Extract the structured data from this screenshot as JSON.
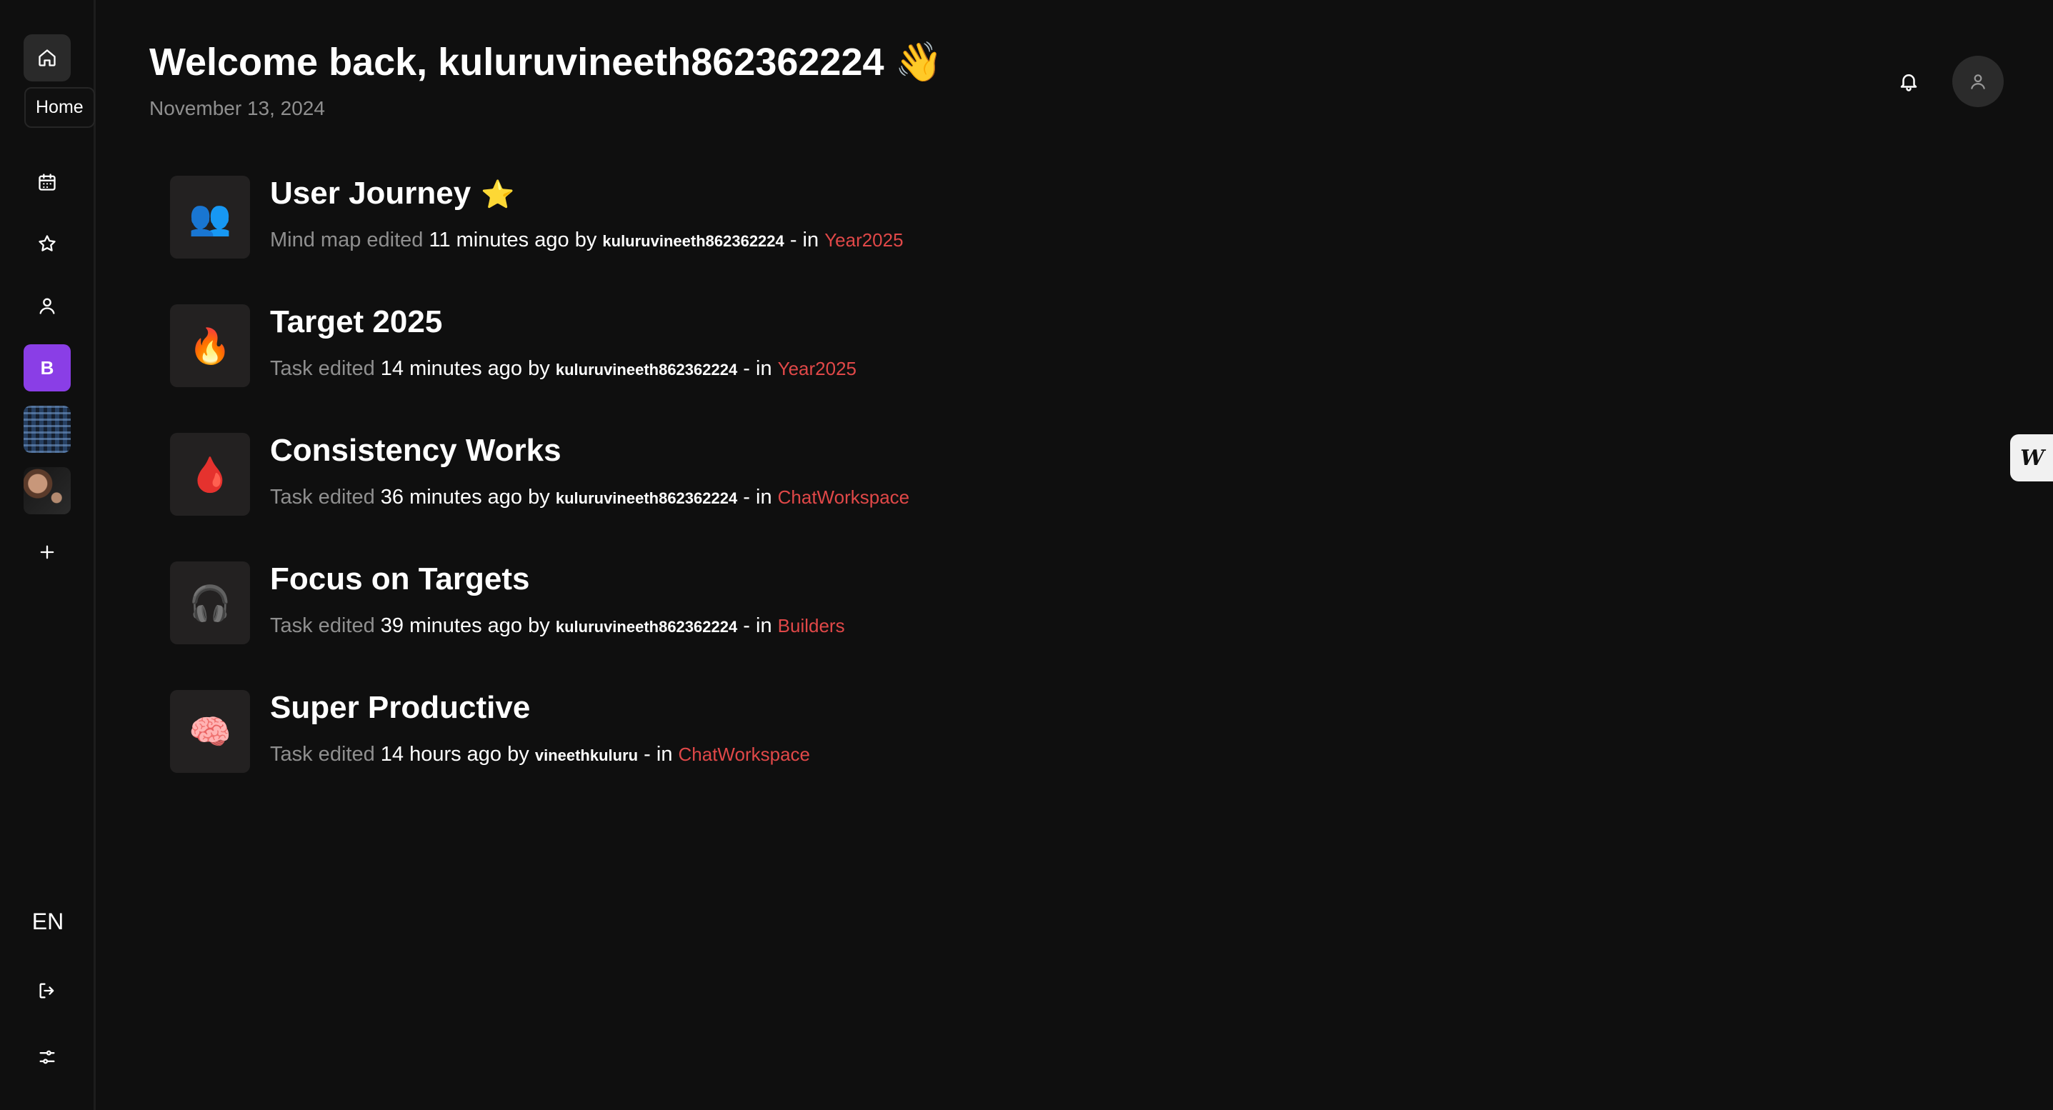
{
  "sidebar": {
    "home_tooltip": "Home",
    "workspace_badge": "B",
    "language": "EN",
    "icons": [
      "home-icon",
      "calendar-icon",
      "star-icon",
      "user-icon",
      "plus-icon",
      "logout-icon",
      "settings-sliders-icon"
    ]
  },
  "header": {
    "title": "Welcome back, kuluruvineeth862362224 👋",
    "date": "November 13, 2024"
  },
  "activity": [
    {
      "icon": "👥",
      "title": "User Journey",
      "starred": true,
      "type": "Mind map edited",
      "time": "11 minutes ago",
      "by": "by",
      "user": "kuluruvineeth862362224",
      "in": "- in",
      "workspace": "Year2025"
    },
    {
      "icon": "🔥",
      "title": "Target 2025",
      "starred": false,
      "type": "Task edited",
      "time": "14 minutes ago",
      "by": "by",
      "user": "kuluruvineeth862362224",
      "in": "- in",
      "workspace": "Year2025"
    },
    {
      "icon": "🩸",
      "title": "Consistency Works",
      "starred": false,
      "type": "Task edited",
      "time": "36 minutes ago",
      "by": "by",
      "user": "kuluruvineeth862362224",
      "in": "- in",
      "workspace": "ChatWorkspace"
    },
    {
      "icon": "🎧",
      "title": "Focus on Targets",
      "starred": false,
      "type": "Task edited",
      "time": "39 minutes ago",
      "by": "by",
      "user": "kuluruvineeth862362224",
      "in": "- in",
      "workspace": "Builders"
    },
    {
      "icon": "🧠",
      "title": "Super Productive",
      "starred": false,
      "type": "Task edited",
      "time": "14 hours ago",
      "by": "by",
      "user": "vineethkuluru",
      "in": "- in",
      "workspace": "ChatWorkspace"
    }
  ],
  "star_glyph": "⭐",
  "side_tab": "W",
  "colors": {
    "background": "#0f0f0f",
    "workspace_link": "#e04848",
    "badge": "#8a3ee6"
  }
}
